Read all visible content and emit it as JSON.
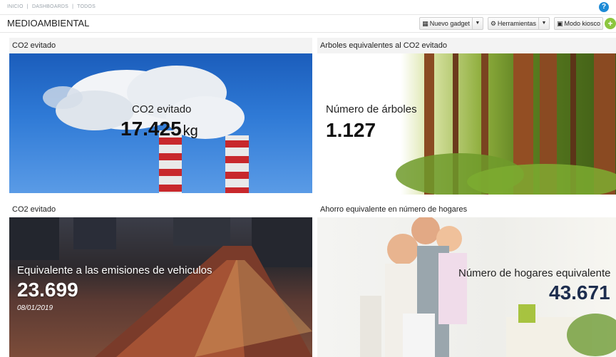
{
  "breadcrumb": {
    "items": [
      "INICIO",
      "|",
      "DASHBOARDS",
      "|",
      "TODOS"
    ]
  },
  "header": {
    "title": "MEDIOAMBIENTAL",
    "toolbar": {
      "new_gadget": "Nuevo gadget",
      "tools": "Herramientas",
      "kiosk": "Modo kiosco"
    }
  },
  "panels": {
    "co2_avoided": {
      "title": "CO2 evitado",
      "label": "CO2 evitado",
      "value": "17.425",
      "unit": "kg"
    },
    "trees": {
      "title": "Arboles equivalentes al CO2 evitado",
      "label": "Número de árboles",
      "value": "1.127"
    },
    "vehicles": {
      "title": "CO2 evitado",
      "label": "Equivalente a las emisiones de vehiculos",
      "value": "23.699",
      "date": "08/01/2019"
    },
    "homes": {
      "title": "Ahorro equivalente en número de hogares",
      "label": "Número de hogares equivalente",
      "value": "43.671"
    }
  },
  "colors": {
    "accent_blue": "#1e8bd6",
    "add_green": "#8cc63f"
  }
}
